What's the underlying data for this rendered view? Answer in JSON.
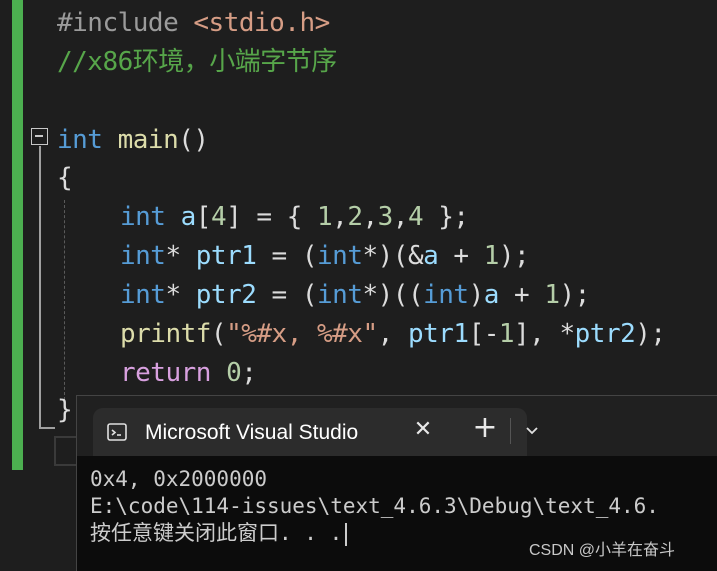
{
  "editor": {
    "lines": {
      "include": {
        "directive": "#include",
        "header": "<stdio.h>"
      },
      "comment": "//x86环境，小端字节序",
      "main_decl": {
        "type": "int",
        "name": "main",
        "parens": "()"
      },
      "open_brace": "{",
      "line_a": {
        "type": "int",
        "id": "a",
        "rest1": "[",
        "num_size": "4",
        "rest2": "] = { ",
        "n1": "1",
        "c1": ",",
        "n2": "2",
        "c2": ",",
        "n3": "3",
        "c3": ",",
        "n4": "4",
        "rest3": " };"
      },
      "line_ptr1": {
        "type": "int",
        "star": "* ",
        "id": "ptr1",
        "eq": " = (",
        "cast_type": "int",
        "cast_end": "*)(&",
        "a": "a",
        "plus": " + ",
        "one": "1",
        "end": ");"
      },
      "line_ptr2": {
        "type": "int",
        "star": "* ",
        "id": "ptr2",
        "eq": " = (",
        "cast_type": "int",
        "cast_mid": "*)((",
        "cast_type2": "int",
        "cast_close": ")",
        "a": "a",
        "plus": " + ",
        "one": "1",
        "end": ");"
      },
      "line_printf": {
        "fn": "printf",
        "open": "(",
        "fmt": "\"%#x, %#x\"",
        "sep1": ", ",
        "arg1": "ptr1",
        "idx": "[-",
        "idx_num": "1",
        "idx_end": "], *",
        "arg2": "ptr2",
        "end": ");"
      },
      "line_return": {
        "kw": "return",
        "space": " ",
        "num": "0",
        "end": ";"
      },
      "close_brace": "}"
    }
  },
  "terminal": {
    "tab_title": "Microsoft Visual Studio",
    "close_glyph": "✕",
    "add_glyph": "+",
    "output": [
      "0x4, 0x2000000",
      "E:\\code\\114-issues\\text_4.6.3\\Debug\\text_4.6.",
      "按任意键关闭此窗口. . ."
    ]
  },
  "watermark": "CSDN @小羊在奋斗",
  "colors": {
    "editor_bg": "#1e1e1e",
    "keyword": "#569cd6",
    "function": "#dcdcaa",
    "number": "#b5cea8",
    "string": "#d69d85",
    "comment": "#57a64a",
    "change_bar": "#4caf50",
    "terminal_bg": "#0c0c0c"
  },
  "icons": [
    "terminal-icon",
    "close-icon",
    "add-tab-icon",
    "chevron-down-icon",
    "collapse-icon"
  ]
}
